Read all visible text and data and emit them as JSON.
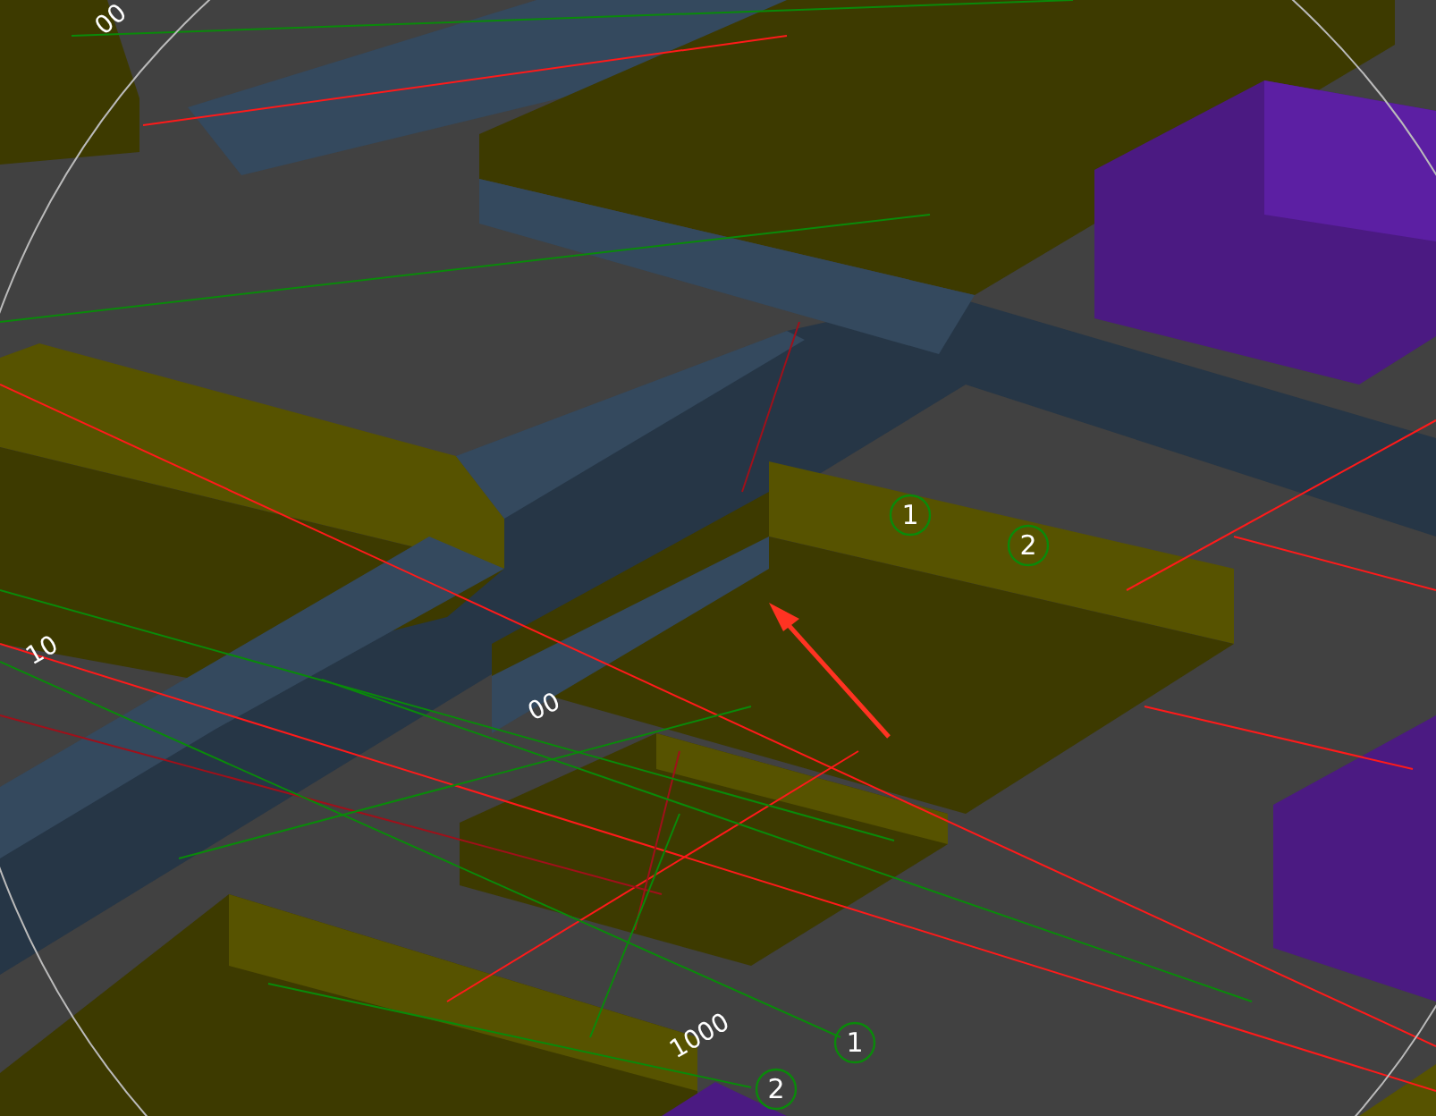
{
  "viewport": {
    "dimension_labels": [
      {
        "text": "00"
      },
      {
        "text": "10"
      },
      {
        "text": "00"
      },
      {
        "text": "1000"
      }
    ],
    "grid_markers": [
      {
        "label": "1"
      },
      {
        "label": "2"
      },
      {
        "label": "1"
      },
      {
        "label": "2"
      }
    ]
  }
}
